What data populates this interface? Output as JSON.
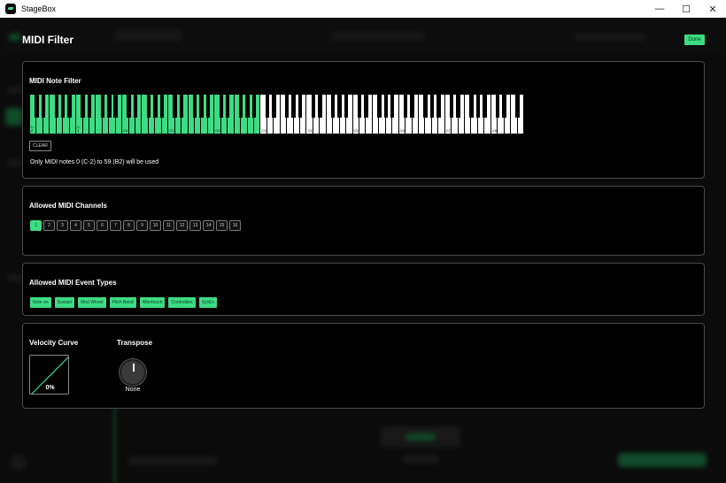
{
  "window": {
    "title": "StageBox",
    "minimize": "—",
    "maximize": "☐",
    "close": "✕"
  },
  "dialog": {
    "title": "MIDI Filter",
    "done_label": "Done"
  },
  "note_filter": {
    "title": "MIDI Note Filter",
    "clear_label": "CLEAR",
    "info": "Only MIDI notes 0 (C-2) to 59 (B2) will be used",
    "octave_labels": [
      "C-2",
      "C-1",
      "C0",
      "C1",
      "C2",
      "C3",
      "C4",
      "C5",
      "C6",
      "C7",
      "C8"
    ],
    "white_key_count": 75,
    "selected_white_keys": 35,
    "selected_color": "#3ddc84"
  },
  "channels": {
    "title": "Allowed MIDI Channels",
    "items": [
      {
        "label": "1",
        "active": true
      },
      {
        "label": "2",
        "active": false
      },
      {
        "label": "3",
        "active": false
      },
      {
        "label": "4",
        "active": false
      },
      {
        "label": "5",
        "active": false
      },
      {
        "label": "6",
        "active": false
      },
      {
        "label": "7",
        "active": false
      },
      {
        "label": "8",
        "active": false
      },
      {
        "label": "9",
        "active": false
      },
      {
        "label": "10",
        "active": false
      },
      {
        "label": "11",
        "active": false
      },
      {
        "label": "12",
        "active": false
      },
      {
        "label": "13",
        "active": false
      },
      {
        "label": "14",
        "active": false
      },
      {
        "label": "15",
        "active": false
      },
      {
        "label": "16",
        "active": false
      }
    ]
  },
  "event_types": {
    "title": "Allowed MIDI Event Types",
    "items": [
      "Note on",
      "Sustain",
      "Mod Wheel",
      "Pitch Bend",
      "Aftertouch",
      "Controllers",
      "SysEx"
    ]
  },
  "velocity": {
    "title": "Velocity Curve",
    "value": "0%"
  },
  "transpose": {
    "title": "Transpose",
    "value": "None"
  },
  "colors": {
    "accent": "#3ddc84",
    "panel_bg": "#000000",
    "panel_border": "#4a4a4a"
  }
}
